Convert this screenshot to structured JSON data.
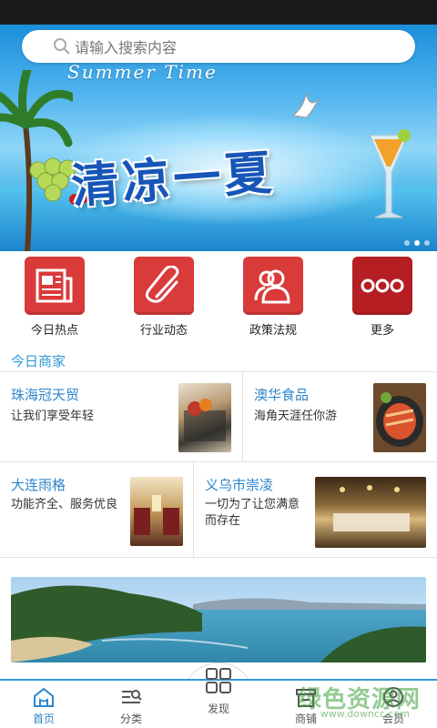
{
  "search": {
    "placeholder": "请输入搜索内容",
    "icon": "search-icon"
  },
  "banner": {
    "overline": "Summer Time",
    "headline": "清凉一夏",
    "slide_count": 3,
    "active_slide": 2
  },
  "categories": [
    {
      "label": "今日热点",
      "icon": "newspaper-icon",
      "color": "#d93a3a"
    },
    {
      "label": "行业动态",
      "icon": "paperclip-icon",
      "color": "#d93a3a"
    },
    {
      "label": "政策法规",
      "icon": "users-icon",
      "color": "#d93a3a"
    },
    {
      "label": "更多",
      "icon": "more-icon",
      "color": "#b51f24"
    }
  ],
  "section": {
    "title": "今日商家"
  },
  "shops": [
    {
      "name": "珠海冠天贸",
      "desc": "让我们享受年轻"
    },
    {
      "name": "澳华食品",
      "desc": "海角天涯任你游"
    },
    {
      "name": "大连雨格",
      "desc": "功能齐全、服务优良"
    },
    {
      "name": "义乌市崇凌",
      "desc_line1": "一切为了让您满意",
      "desc_line2": "而存在"
    }
  ],
  "tabs": [
    {
      "label": "首页",
      "icon": "home-icon",
      "active": true
    },
    {
      "label": "分类",
      "icon": "category-icon",
      "active": false
    },
    {
      "label": "发现",
      "icon": "grid-icon",
      "active": false
    },
    {
      "label": "商铺",
      "icon": "shop-icon",
      "active": false
    },
    {
      "label": "会员",
      "icon": "user-icon",
      "active": false
    }
  ],
  "watermark": {
    "text": "绿色资源网",
    "url": "www.downcc.com"
  },
  "colors": {
    "accent": "#2e9ad8",
    "tile_red": "#d93a3a",
    "tile_dark_red": "#b51f24"
  }
}
